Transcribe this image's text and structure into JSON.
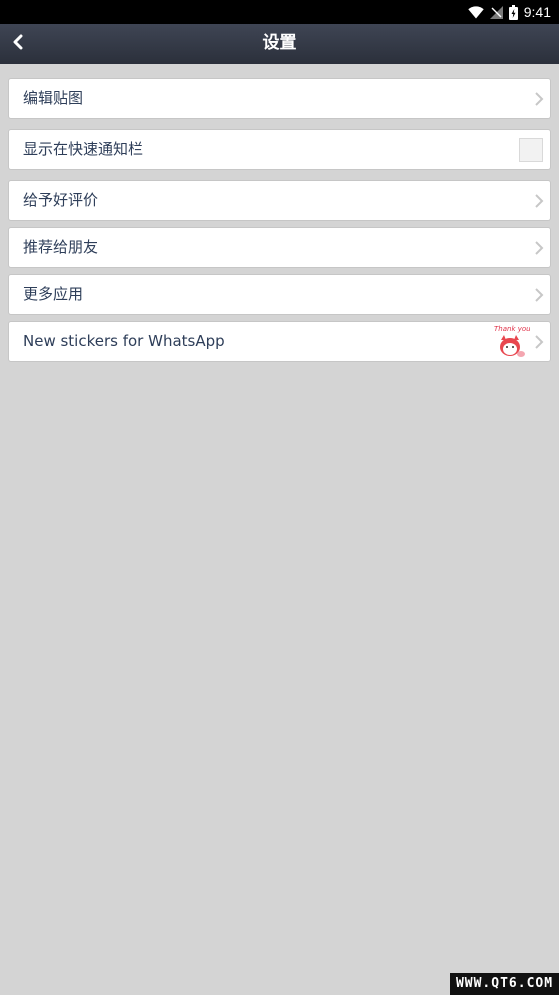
{
  "status_bar": {
    "time": "9:41",
    "icons": [
      "wifi-icon",
      "no-signal-icon",
      "battery-charging-icon"
    ]
  },
  "app_bar": {
    "title": "设置",
    "back_icon": "chevron-left-icon"
  },
  "settings": {
    "items": [
      {
        "label": "编辑贴图",
        "control": "chevron"
      },
      {
        "label": "显示在快速通知栏",
        "control": "checkbox",
        "checked": false
      },
      {
        "label": "给予好评价",
        "control": "chevron"
      },
      {
        "label": "推荐给朋友",
        "control": "chevron"
      },
      {
        "label": "更多应用",
        "control": "chevron"
      },
      {
        "label": "New stickers for WhatsApp",
        "control": "chevron",
        "thumbnail_text": "Thank you"
      }
    ]
  },
  "watermark": "WWW.QT6.COM",
  "colors": {
    "status_bar_bg": "#000000",
    "app_bar_bg": "#343a47",
    "page_bg": "#d4d4d4",
    "row_bg": "#ffffff",
    "row_text": "#2e3e59",
    "chevron": "#c7c7c7"
  }
}
